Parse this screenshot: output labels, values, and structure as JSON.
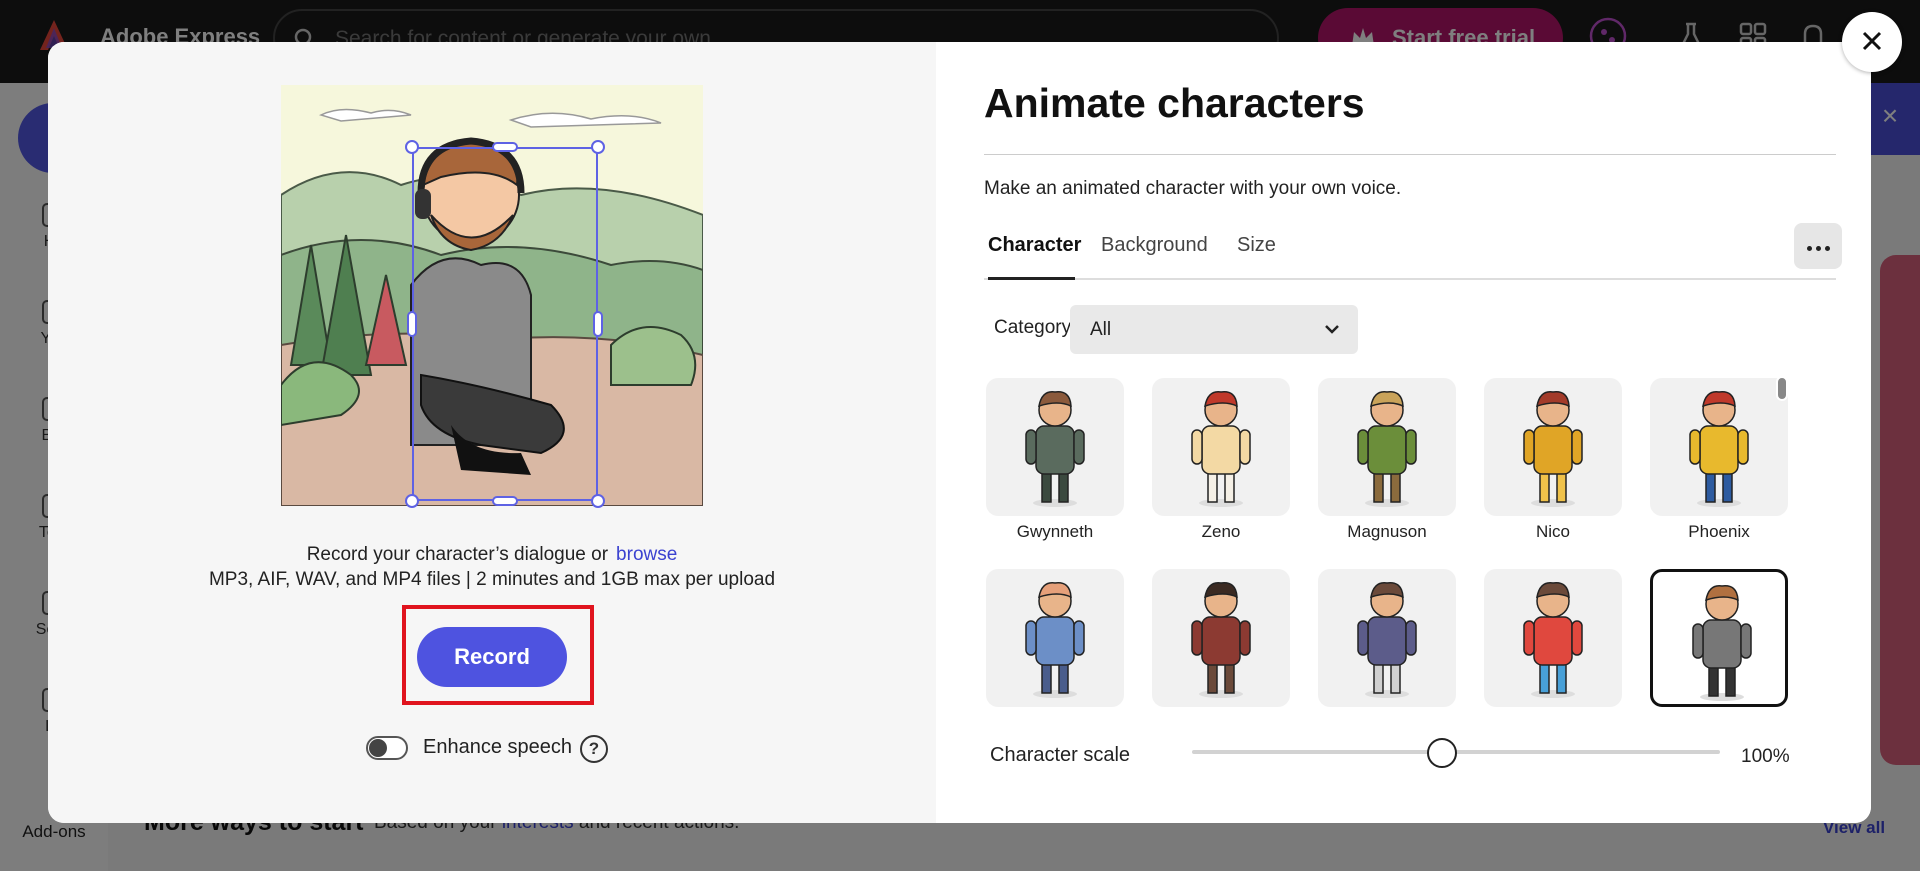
{
  "app": {
    "brand": "Adobe Express",
    "search_placeholder": "Search for content or generate your own",
    "trial_label": "Start free trial"
  },
  "rail": {
    "items": [
      "Ho",
      "You",
      "Bra",
      "Tem",
      "Sche",
      "Le"
    ],
    "addons": "Add-ons"
  },
  "background_section": {
    "title": "More ways to start",
    "subtitle_prefix": "Based on your",
    "subtitle_link": "interests",
    "subtitle_suffix": "and recent actions.",
    "view_all": "View all"
  },
  "modal": {
    "title": "Animate characters",
    "subtitle": "Make an animated character with your own voice.",
    "tabs": [
      {
        "label": "Character",
        "active": true
      },
      {
        "label": "Background",
        "active": false
      },
      {
        "label": "Size",
        "active": false
      }
    ],
    "category_label": "Category",
    "category_value": "All",
    "characters": [
      {
        "name": "Gwynneth",
        "palette": [
          "#5a6b5e",
          "#8b5a3c",
          "#3b4a3f"
        ]
      },
      {
        "name": "Zeno",
        "palette": [
          "#f3d9a4",
          "#c0392b",
          "#f5f0e6"
        ]
      },
      {
        "name": "Magnuson",
        "palette": [
          "#6b8e3a",
          "#c9a35a",
          "#8b6b3d"
        ]
      },
      {
        "name": "Nico",
        "palette": [
          "#e0a526",
          "#a33b2a",
          "#f0c24a"
        ]
      },
      {
        "name": "Phoenix",
        "palette": [
          "#e8b92d",
          "#c0392b",
          "#2d5ba0"
        ]
      },
      {
        "name": "",
        "palette": [
          "#6c8fc7",
          "#e6a07a",
          "#4a5d8c"
        ]
      },
      {
        "name": "",
        "palette": [
          "#8c3a32",
          "#3b2a22",
          "#6b4a3a"
        ]
      },
      {
        "name": "",
        "palette": [
          "#5c5c8a",
          "#6b4a3a",
          "#d0d0d0"
        ]
      },
      {
        "name": "",
        "palette": [
          "#e0483e",
          "#6b4a3a",
          "#48a0d8"
        ]
      },
      {
        "name": "",
        "palette": [
          "#777777",
          "#b07040",
          "#333333"
        ],
        "selected": true
      }
    ],
    "scale_label": "Character scale",
    "scale_value": "100%",
    "scale_level": 0.5,
    "record_text": "Record your character’s dialogue or",
    "browse_label": "browse",
    "file_info": "MP3, AIF, WAV, and MP4 files | 2 minutes and 1GB max per upload",
    "record_label": "Record",
    "enhance_label": "Enhance speech",
    "enhance_on": false
  },
  "colors": {
    "accent": "#4e53e0",
    "highlight": "#e0141e",
    "trial": "#b4146a"
  }
}
